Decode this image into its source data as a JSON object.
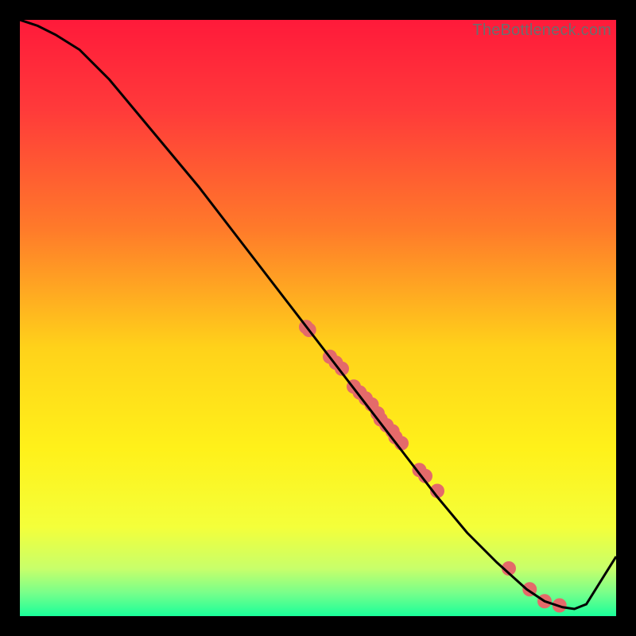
{
  "watermark": "TheBottleneck.com",
  "chart_data": {
    "type": "line",
    "title": "",
    "xlabel": "",
    "ylabel": "",
    "xlim": [
      0,
      100
    ],
    "ylim": [
      0,
      100
    ],
    "background_gradient": {
      "stops": [
        {
          "pos": 0.0,
          "color": "#ff1a3a"
        },
        {
          "pos": 0.15,
          "color": "#ff3a3a"
        },
        {
          "pos": 0.35,
          "color": "#ff7a2a"
        },
        {
          "pos": 0.55,
          "color": "#ffd21a"
        },
        {
          "pos": 0.72,
          "color": "#fff11a"
        },
        {
          "pos": 0.85,
          "color": "#f4ff3a"
        },
        {
          "pos": 0.92,
          "color": "#c8ff6a"
        },
        {
          "pos": 0.96,
          "color": "#7aff8a"
        },
        {
          "pos": 1.0,
          "color": "#1aff9a"
        }
      ]
    },
    "series": [
      {
        "name": "curve",
        "stroke": "#000000",
        "x": [
          0,
          3,
          6,
          10,
          15,
          20,
          25,
          30,
          35,
          40,
          45,
          50,
          55,
          60,
          65,
          70,
          75,
          80,
          85,
          88,
          91,
          93,
          95,
          100
        ],
        "y": [
          100,
          99,
          97.5,
          95,
          90,
          84,
          78,
          72,
          65.5,
          59,
          52.5,
          46,
          39.5,
          33,
          26.5,
          20,
          14,
          9,
          4.5,
          2.5,
          1.5,
          1.2,
          2,
          10
        ]
      }
    ],
    "points": {
      "name": "markers",
      "color": "#e46a6a",
      "radius": 9,
      "xy": [
        [
          48,
          48.5
        ],
        [
          48.5,
          48
        ],
        [
          52,
          43.5
        ],
        [
          53,
          42.5
        ],
        [
          54,
          41.5
        ],
        [
          56,
          38.5
        ],
        [
          57,
          37.5
        ],
        [
          58,
          36.5
        ],
        [
          59,
          35.5
        ],
        [
          60,
          34
        ],
        [
          60.5,
          33
        ],
        [
          61.5,
          32
        ],
        [
          62.5,
          31
        ],
        [
          63,
          30
        ],
        [
          64,
          29
        ],
        [
          67,
          24.5
        ],
        [
          68,
          23.5
        ],
        [
          70,
          21
        ],
        [
          82,
          8
        ],
        [
          85.5,
          4.5
        ],
        [
          88,
          2.5
        ],
        [
          90.5,
          1.8
        ]
      ]
    }
  }
}
